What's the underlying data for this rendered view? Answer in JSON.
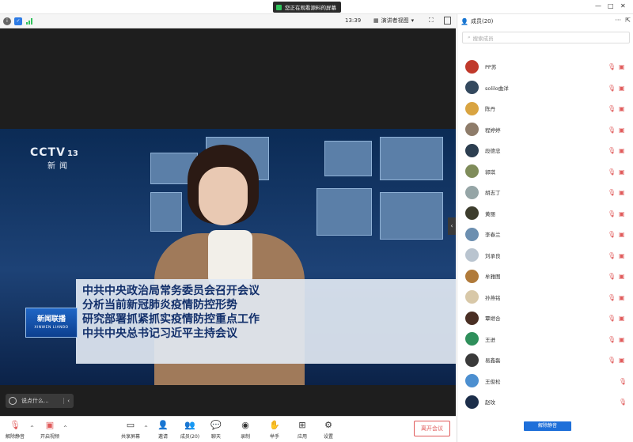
{
  "titlebar": {
    "share_notice": "您正在观看源料的屏幕",
    "min": "—",
    "max": "□",
    "close": "✕"
  },
  "toolbar": {
    "time": "13:39",
    "speaker_view": "演讲者视图"
  },
  "video": {
    "channel_brand": "CCTV",
    "channel_num": "13",
    "channel_sub": "新闻",
    "news_logo": "新闻联播",
    "news_logo_sub": "XINWEN LIANBO",
    "caption_lines": [
      "中共中央政治局常务委员会召开会议",
      "分析当前新冠肺炎疫情防控形势",
      "研究部署抓紧抓实疫情防控重点工作",
      "中共中央总书记习近平主持会议"
    ]
  },
  "chat": {
    "placeholder": "说点什么..."
  },
  "bottombar": {
    "unmute": "解除静音",
    "start_video": "开启视频",
    "share_screen": "共享屏幕",
    "invite": "邀请",
    "members": "成员(20)",
    "chat": "聊天",
    "record": "录制",
    "raise_hand": "举手",
    "apps": "应用",
    "settings": "设置",
    "leave": "离开会议"
  },
  "panel": {
    "title": "成员(20)",
    "search_placeholder": "搜索成员",
    "unmute_all": "解除静音",
    "members": [
      {
        "name": "PP苏",
        "color": "#c0392b"
      },
      {
        "name": "solilo曲洋",
        "color": "#34495e"
      },
      {
        "name": "陈丹",
        "color": "#d9a441"
      },
      {
        "name": "程婷婷",
        "color": "#8e7c6a"
      },
      {
        "name": "段德忠",
        "color": "#2c3e50"
      },
      {
        "name": "郭琪",
        "color": "#7f8c5a"
      },
      {
        "name": "胡志丁",
        "color": "#95a5a6"
      },
      {
        "name": "黄丽",
        "color": "#3d3d2d"
      },
      {
        "name": "李春兰",
        "color": "#6c8fb0"
      },
      {
        "name": "刘承良",
        "color": "#b9c4cf"
      },
      {
        "name": "牟雅图",
        "color": "#b07a3a"
      },
      {
        "name": "孙燕铭",
        "color": "#d8c8a8"
      },
      {
        "name": "覃继合",
        "color": "#4a2f24"
      },
      {
        "name": "王进",
        "color": "#2f8f5b"
      },
      {
        "name": "易鑫磊",
        "color": "#3a3a3a"
      },
      {
        "name": "王俊松",
        "color": "#4c8fd0"
      },
      {
        "name": "赵玟",
        "color": "#1c2e4a"
      }
    ]
  },
  "icons": {
    "mic_off": "mic-off-icon",
    "cam_off": "camera-off-icon"
  }
}
